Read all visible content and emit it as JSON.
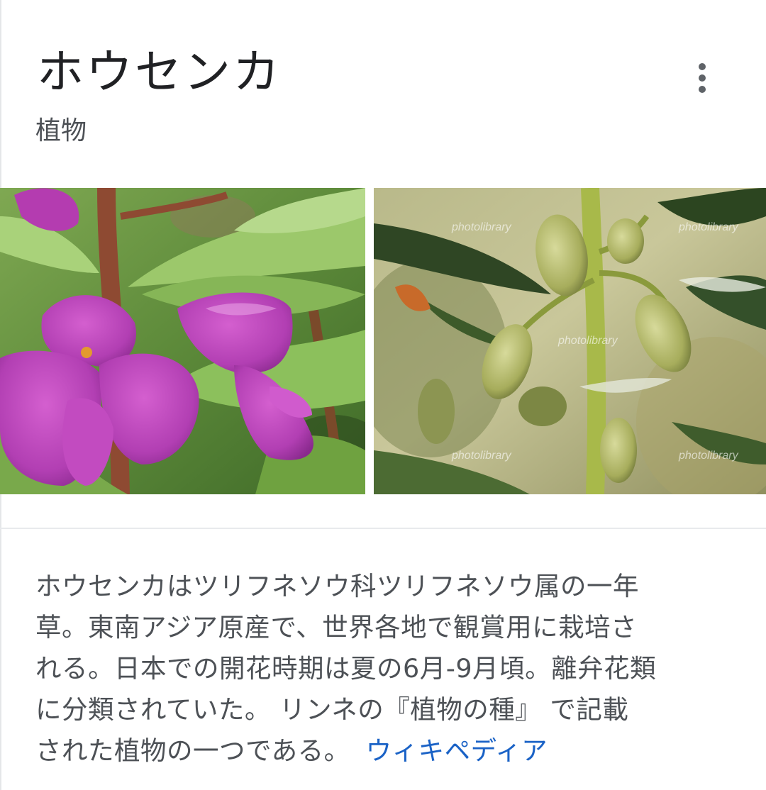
{
  "panel": {
    "title": "ホウセンカ",
    "subtitle": "植物",
    "more_icon": "more-vert-icon"
  },
  "images": [
    {
      "subject": "pink balsam flowers with leaves"
    },
    {
      "subject": "green seed pods on stem",
      "watermarks": [
        "photolibrary",
        "photolibrary",
        "photolibrary",
        "photolibrary",
        "photolibrary"
      ]
    }
  ],
  "description": {
    "lines": [
      "ホウセンカはツリフネソウ科ツリフネソウ属の一年",
      "草。東南アジア原産で、世界各地で観賞用に栽培さ",
      "れる。日本での開花時期は夏の6月-9月頃。離弁花類",
      "に分類されていた。 リンネの『植物の種』 で記載",
      "された植物の一つである。"
    ],
    "source_link": "ウィキペディア"
  },
  "colors": {
    "title": "#202124",
    "body_text": "#4d5156",
    "link": "#1a62c6",
    "divider": "#e8eaed"
  }
}
